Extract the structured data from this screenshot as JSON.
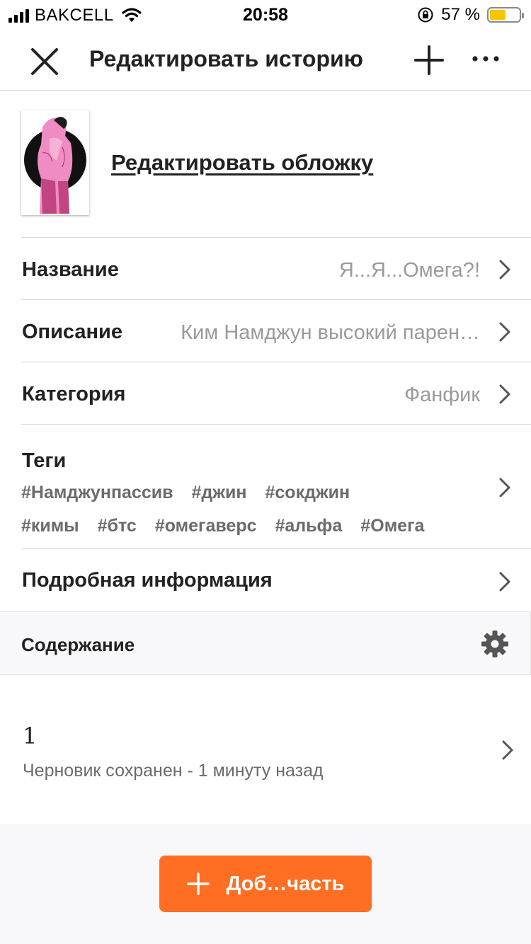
{
  "status_bar": {
    "carrier": "BAKCELL",
    "time": "20:58",
    "battery_percent": "57 %",
    "battery_level": 0.57,
    "battery_color": "#f7c600"
  },
  "header": {
    "title": "Редактировать историю",
    "close_icon": "close-icon",
    "add_icon": "plus-icon",
    "more_icon": "more-icon"
  },
  "cover": {
    "edit_label": "Редактировать обложку"
  },
  "fields": {
    "title": {
      "label": "Название",
      "value": "Я...Я...Омега?!"
    },
    "description": {
      "label": "Описание",
      "value": "Ким Намджун высокий парен…"
    },
    "category": {
      "label": "Категория",
      "value": "Фанфик"
    },
    "tags": {
      "label": "Теги",
      "line1": [
        "#Намджунпассив",
        "#джин",
        "#сокджин"
      ],
      "line2": [
        "#кимы",
        "#бтс",
        "#омегаверс",
        "#альфа",
        "#Омега"
      ]
    },
    "details": {
      "label": "Подробная информация"
    }
  },
  "contents": {
    "label": "Содержание",
    "settings_icon": "gear-icon"
  },
  "parts": [
    {
      "number": "1",
      "status": "Черновик сохранен - 1 минуту назад"
    }
  ],
  "footer": {
    "add_label": "Доб…часть",
    "accent": "#ff6e22"
  }
}
